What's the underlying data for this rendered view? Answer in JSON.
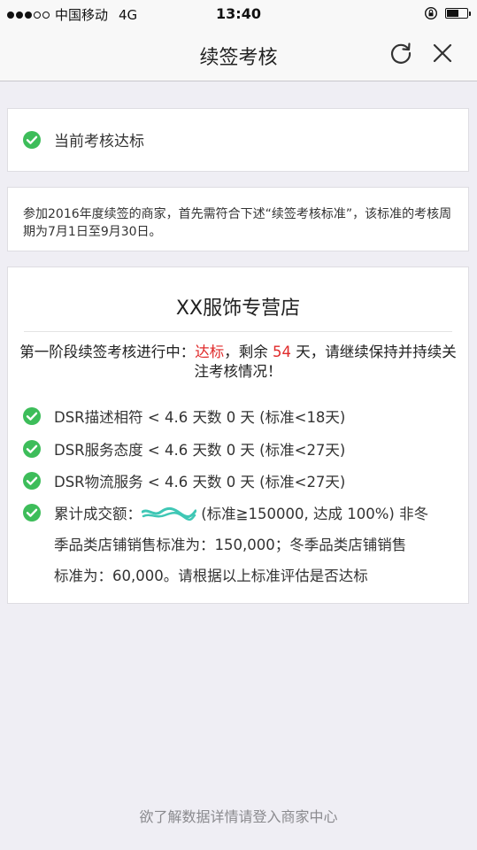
{
  "status_bar": {
    "carrier": "中国移动",
    "network": "4G",
    "time": "13:40",
    "battery_level": 0.6
  },
  "nav": {
    "title": "续签考核",
    "refresh_icon": "refresh-icon",
    "close_icon": "close-icon"
  },
  "status_card": {
    "text": "当前考核达标",
    "icon": "check-circle-icon",
    "icon_color": "#3dbd5a"
  },
  "notice": {
    "text": "参加2016年度续签的商家，首先需符合下述“续签考核标准”，该标准的考核周期为7月1日至9月30日。"
  },
  "store": {
    "name": "XX服饰专营店",
    "stage_prefix": "第一阶段续签考核进行中：",
    "stage_status": "达标",
    "stage_mid": "，剩余",
    "days_left": "54",
    "stage_suffix": "天，请继续保持并持续关注考核情况！",
    "highlight_color": "#e02a2a",
    "metrics": [
      {
        "text": "DSR描述相符 < 4.6 天数 0 天 (标准<18天)"
      },
      {
        "text": "DSR服务态度 < 4.6 天数 0 天 (标准<27天)"
      },
      {
        "text": "DSR物流服务 < 4.6 天数 0 天 (标准<27天)"
      }
    ],
    "sales": {
      "label": "累计成交额：",
      "line1_rest": "(标准≧150000, 达成 100%) 非冬",
      "line2": "季品类店铺销售标准为：150,000；冬季品类店铺销售",
      "line3": "标准为：60,000。请根据以上标准评估是否达标"
    }
  },
  "footer": {
    "text": "欲了解数据详情请登入商家中心"
  }
}
